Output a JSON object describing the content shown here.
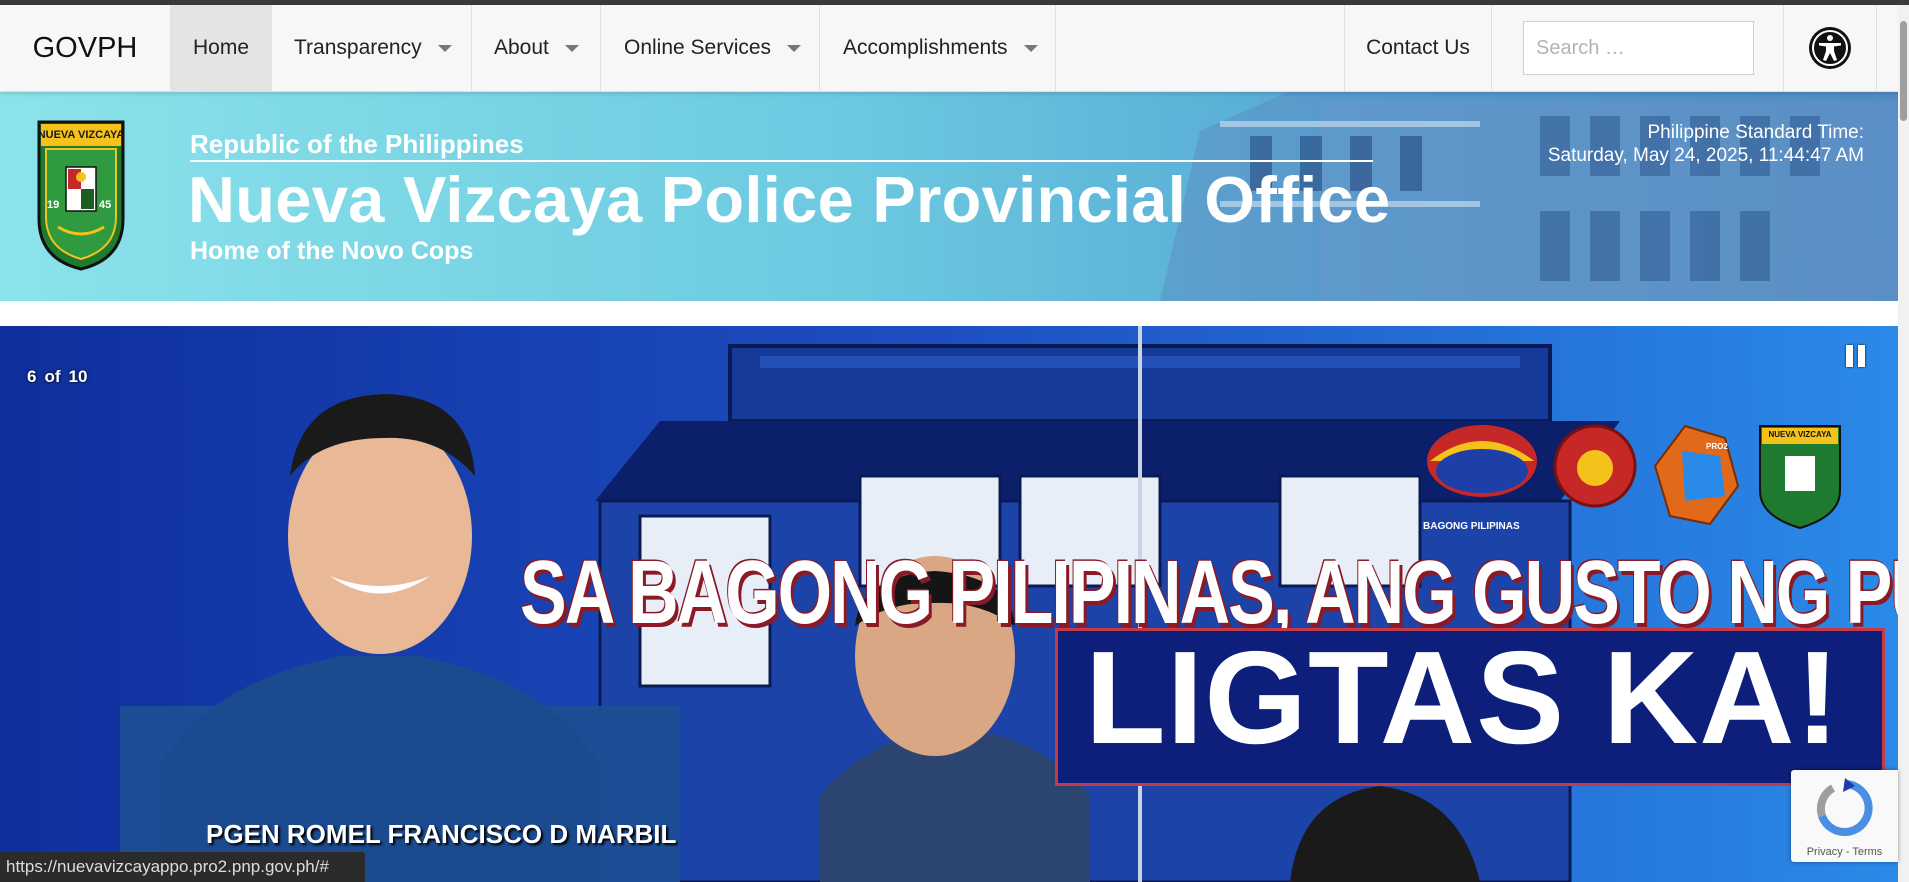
{
  "nav": {
    "brand": "GOVPH",
    "items": [
      {
        "label": "Home"
      },
      {
        "label": "Transparency"
      },
      {
        "label": "About"
      },
      {
        "label": "Online Services"
      },
      {
        "label": "Accomplishments"
      }
    ],
    "contact": "Contact Us",
    "search_placeholder": "Search …",
    "accessibility_icon": "accessibility-icon"
  },
  "header": {
    "republic": "Republic of the Philippines",
    "title": "Nueva Vizcaya Police Provincial Office",
    "tagline": "Home of the Novo Cops",
    "pst_label": "Philippine Standard Time:",
    "pst_value": "Saturday, May 24, 2025, 11:44:47 AM",
    "seal": {
      "top_text": "NUEVA VIZCAYA",
      "year_left": "19",
      "year_right": "45"
    }
  },
  "slider": {
    "current": "6",
    "of_label": "of",
    "total": "10",
    "headline": "SA BAGONG PILIPINAS, ANG GUSTO NG PULIS,",
    "emphasis": "LIGTAS KA!",
    "caption": "PGEN ROMEL FRANCISCO D MARBIL",
    "logo_caption": "BAGONG PILIPINAS",
    "logo_badge": "NUEVA VIZCAYA",
    "logo_pro": "PRO2"
  },
  "status_url": "https://nuevavizcayappo.pro2.pnp.gov.ph/#",
  "recaptcha": {
    "privacy": "Privacy",
    "separator": " - ",
    "terms": "Terms"
  },
  "colors": {
    "header_start": "#8be3ea",
    "header_end": "#4a8fc4",
    "slider_bg": "#1a3ca6",
    "headline_shadow": "#8a1a25"
  }
}
